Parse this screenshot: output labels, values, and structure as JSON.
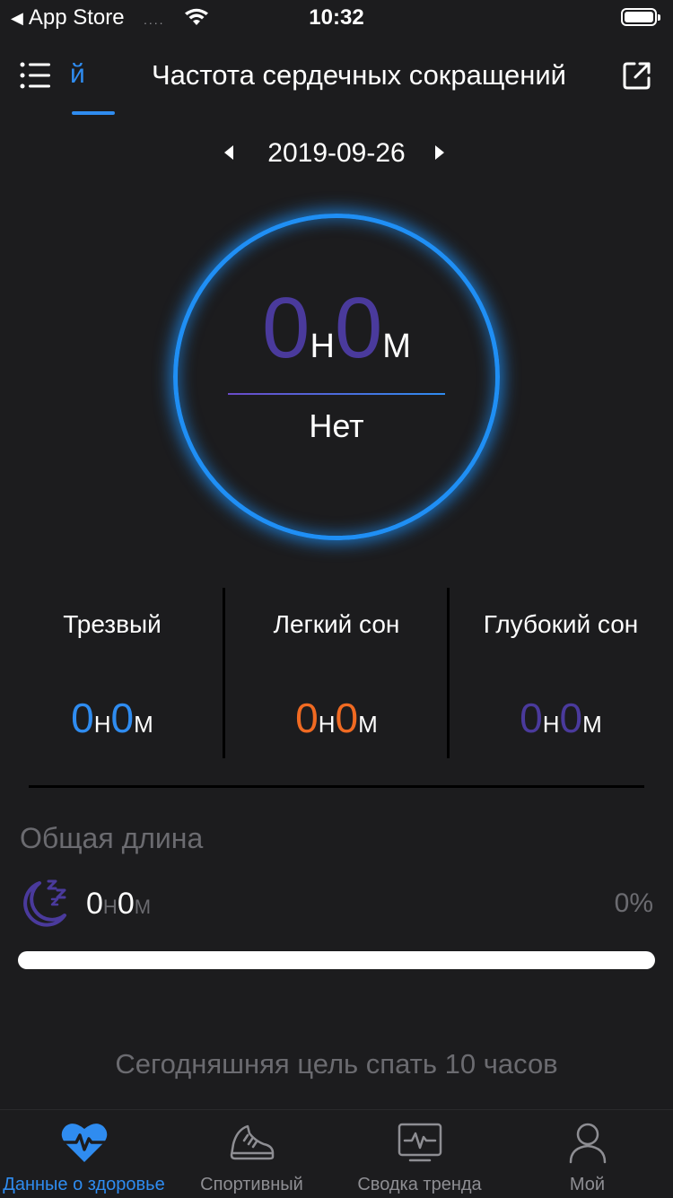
{
  "status_bar": {
    "back_app": "App Store",
    "signal": "....",
    "time": "10:32"
  },
  "header": {
    "tab_partial": "й",
    "title": "Частота сердечных сокращений"
  },
  "date": "2019-09-26",
  "ring": {
    "hours": "0",
    "hours_unit": "Н",
    "minutes": "0",
    "minutes_unit": "М",
    "label": "Нет"
  },
  "stats": [
    {
      "label": "Трезвый",
      "hours": "0",
      "hours_unit": "Н",
      "minutes": "0",
      "minutes_unit": "М",
      "color": "#2f8cf0"
    },
    {
      "label": "Легкий сон",
      "hours": "0",
      "hours_unit": "Н",
      "minutes": "0",
      "minutes_unit": "М",
      "color": "#f06a22"
    },
    {
      "label": "Глубокий сон",
      "hours": "0",
      "hours_unit": "Н",
      "minutes": "0",
      "minutes_unit": "М",
      "color": "#4a3a9c"
    }
  ],
  "total": {
    "title": "Общая длина",
    "hours": "0",
    "hours_unit": "Н",
    "minutes": "0",
    "minutes_unit": "М",
    "percent": "0%",
    "progress": 0
  },
  "goal_text": "Сегодняшняя цель спать 10 часов",
  "bottom_nav": [
    {
      "label": "Данные о здоровье",
      "icon": "heart-pulse-icon",
      "active": true
    },
    {
      "label": "Спортивный",
      "icon": "sneaker-icon",
      "active": false
    },
    {
      "label": "Сводка тренда",
      "icon": "trend-monitor-icon",
      "active": false
    },
    {
      "label": "Мой",
      "icon": "person-icon",
      "active": false
    }
  ],
  "colors": {
    "accent": "#2f8cf0",
    "light_sleep": "#f06a22",
    "deep_sleep": "#4a3a9c",
    "background": "#1c1c1e"
  }
}
